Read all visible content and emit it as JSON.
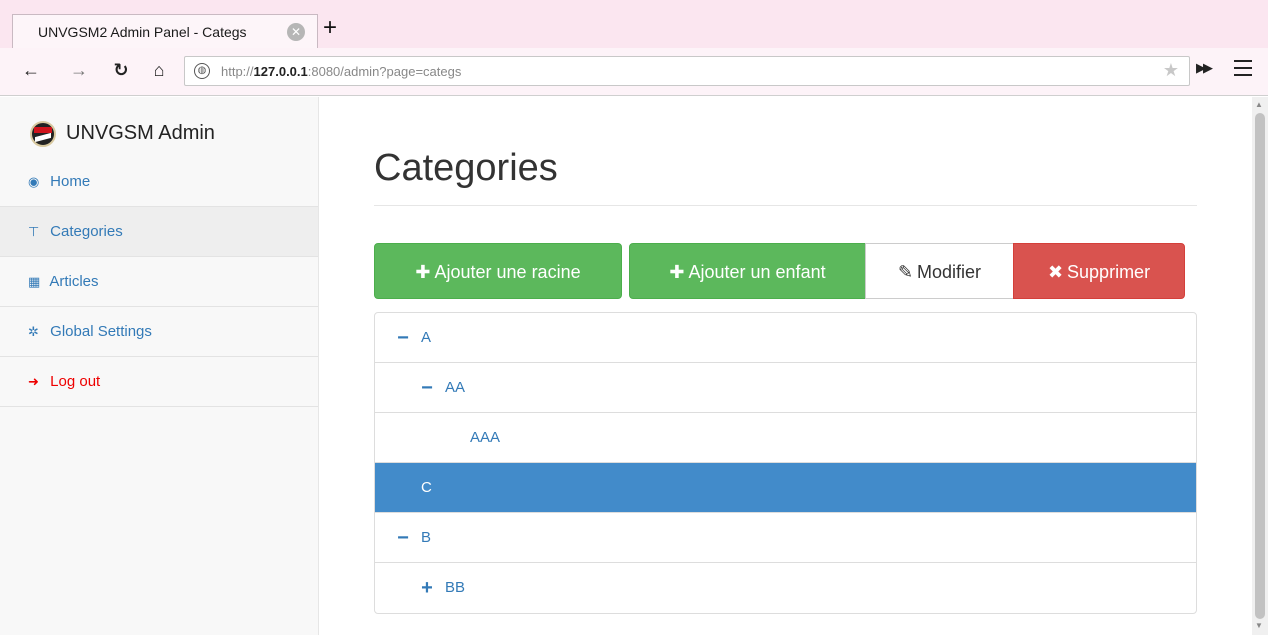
{
  "browser": {
    "tab_title": "UNVGSM2 Admin Panel - Categs",
    "tab_close_icon": "close-icon",
    "new_tab_label": "+",
    "url_prefix": "http://",
    "url_host": "127.0.0.1",
    "url_rest": ":8080/admin?page=categs"
  },
  "sidebar": {
    "brand": "UNVGSM Admin",
    "items": [
      {
        "label": "Home",
        "icon": "dashboard-icon"
      },
      {
        "label": "Categories",
        "icon": "sitemap-icon",
        "active": true
      },
      {
        "label": "Articles",
        "icon": "table-icon"
      },
      {
        "label": "Global Settings",
        "icon": "gear-icon"
      },
      {
        "label": "Log out",
        "icon": "logout-icon",
        "color": "#ee0000"
      }
    ]
  },
  "main": {
    "title": "Categories",
    "buttons": {
      "add_root": "Ajouter une racine",
      "add_child": "Ajouter un enfant",
      "edit": "Modifier",
      "delete": "Supprimer"
    },
    "tree": [
      {
        "label": "A",
        "toggle": "−",
        "selected": false
      },
      {
        "label": "AA",
        "toggle": "−",
        "selected": false
      },
      {
        "label": "AAA",
        "toggle": "",
        "selected": false
      },
      {
        "label": "C",
        "toggle": "",
        "selected": true
      },
      {
        "label": "B",
        "toggle": "−",
        "selected": false
      },
      {
        "label": "BB",
        "toggle": "+",
        "selected": false
      }
    ]
  },
  "colors": {
    "link": "#337ab7",
    "success": "#5cb85c",
    "danger": "#d9534f",
    "selected": "#428bca",
    "tabbar": "#fbe6f0"
  }
}
